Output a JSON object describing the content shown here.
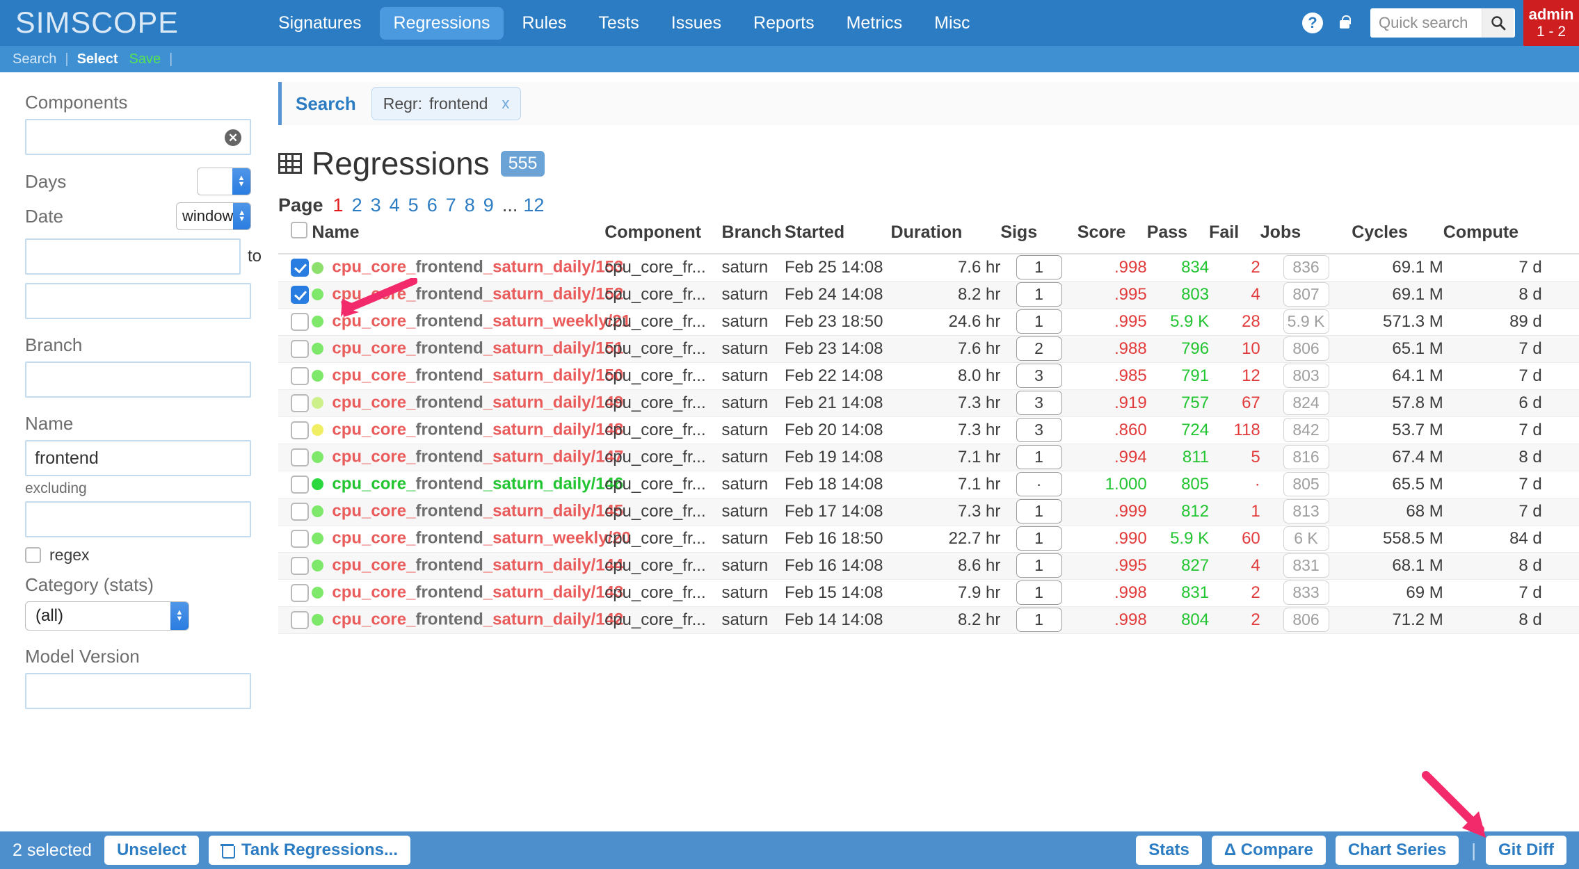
{
  "brand": "SIMSCOPE",
  "nav": {
    "items": [
      {
        "label": "Signatures",
        "active": false
      },
      {
        "label": "Regressions",
        "active": true
      },
      {
        "label": "Rules",
        "active": false
      },
      {
        "label": "Tests",
        "active": false
      },
      {
        "label": "Issues",
        "active": false
      },
      {
        "label": "Reports",
        "active": false
      },
      {
        "label": "Metrics",
        "active": false
      },
      {
        "label": "Misc",
        "active": false
      }
    ],
    "help_icon": "help-circle-icon",
    "lock_icon": "lock-icon",
    "search_icon": "search-icon",
    "quick_search_placeholder": "Quick search",
    "quick_search_value": "",
    "user_name": "admin",
    "user_sub": "1 - 2"
  },
  "subnav": {
    "search": "Search",
    "sep": "|",
    "select": "Select",
    "save": "Save",
    "sep2": "|"
  },
  "sidebar": {
    "components_label": "Components",
    "components_value": "",
    "clear_icon": "clear-circle-icon",
    "days_label": "Days",
    "days_value": "",
    "date_label": "Date",
    "date_mode": "window",
    "date_from": "",
    "date_to_label": "to",
    "date_to": "",
    "branch_label": "Branch",
    "branch_value": "",
    "name_label": "Name",
    "name_value": "frontend",
    "excluding_label": "excluding",
    "excluding_value": "",
    "regex_label": "regex",
    "category_label": "Category (stats)",
    "category_value": "(all)",
    "model_version_label": "Model Version"
  },
  "search_panel": {
    "title": "Search",
    "chip_key": "Regr:",
    "chip_value": "frontend",
    "chip_close": "x"
  },
  "page": {
    "grid_icon": "grid-icon",
    "title": "Regressions",
    "count": "555",
    "pager_label": "Page",
    "pages": [
      "1",
      "2",
      "3",
      "4",
      "5",
      "6",
      "7",
      "8",
      "9"
    ],
    "pager_dots": "...",
    "last_page": "12",
    "current_page": "1"
  },
  "table": {
    "columns": [
      "Name",
      "Component",
      "Branch",
      "Started",
      "Duration",
      "Sigs",
      "Score",
      "Pass",
      "Fail",
      "Jobs",
      "Cycles",
      "Compute",
      ""
    ],
    "rows": [
      {
        "checked": true,
        "dot": "#8ce06b",
        "name_pre": "cpu_core_",
        "name_match": "frontend",
        "name_post": "_saturn_daily/153",
        "ok": false,
        "component": "cpu_core_fr...",
        "branch": "saturn",
        "started": "Feb 25 14:08",
        "duration": "7.6 hr",
        "sigs": "1",
        "score": ".998",
        "pass": "834",
        "fail": "2",
        "jobs": "836",
        "cycles": "69.1 M",
        "compute": "7 d"
      },
      {
        "checked": true,
        "dot": "#7ee86a",
        "name_pre": "cpu_core_",
        "name_match": "frontend",
        "name_post": "_saturn_daily/152",
        "ok": false,
        "component": "cpu_core_fr...",
        "branch": "saturn",
        "started": "Feb 24 14:08",
        "duration": "8.2 hr",
        "sigs": "1",
        "score": ".995",
        "pass": "803",
        "fail": "4",
        "jobs": "807",
        "cycles": "69.1 M",
        "compute": "8 d"
      },
      {
        "checked": false,
        "dot": "#7ee86a",
        "name_pre": "cpu_core_",
        "name_match": "frontend",
        "name_post": "_saturn_weekly/21",
        "ok": false,
        "component": "cpu_core_fr...",
        "branch": "saturn",
        "started": "Feb 23 18:50",
        "duration": "24.6 hr",
        "sigs": "1",
        "score": ".995",
        "pass": "5.9 K",
        "fail": "28",
        "jobs": "5.9 K",
        "cycles": "571.3 M",
        "compute": "89 d"
      },
      {
        "checked": false,
        "dot": "#7ee86a",
        "name_pre": "cpu_core_",
        "name_match": "frontend",
        "name_post": "_saturn_daily/151",
        "ok": false,
        "component": "cpu_core_fr...",
        "branch": "saturn",
        "started": "Feb 23 14:08",
        "duration": "7.6 hr",
        "sigs": "2",
        "score": ".988",
        "pass": "796",
        "fail": "10",
        "jobs": "806",
        "cycles": "65.1 M",
        "compute": "7 d"
      },
      {
        "checked": false,
        "dot": "#7ee86a",
        "name_pre": "cpu_core_",
        "name_match": "frontend",
        "name_post": "_saturn_daily/150",
        "ok": false,
        "component": "cpu_core_fr...",
        "branch": "saturn",
        "started": "Feb 22 14:08",
        "duration": "8.0 hr",
        "sigs": "3",
        "score": ".985",
        "pass": "791",
        "fail": "12",
        "jobs": "803",
        "cycles": "64.1 M",
        "compute": "7 d"
      },
      {
        "checked": false,
        "dot": "#cdf08a",
        "name_pre": "cpu_core_",
        "name_match": "frontend",
        "name_post": "_saturn_daily/149",
        "ok": false,
        "component": "cpu_core_fr...",
        "branch": "saturn",
        "started": "Feb 21 14:08",
        "duration": "7.3 hr",
        "sigs": "3",
        "score": ".919",
        "pass": "757",
        "fail": "67",
        "jobs": "824",
        "cycles": "57.8 M",
        "compute": "6 d"
      },
      {
        "checked": false,
        "dot": "#f0ee63",
        "name_pre": "cpu_core_",
        "name_match": "frontend",
        "name_post": "_saturn_daily/148",
        "ok": false,
        "component": "cpu_core_fr...",
        "branch": "saturn",
        "started": "Feb 20 14:08",
        "duration": "7.3 hr",
        "sigs": "3",
        "score": ".860",
        "pass": "724",
        "fail": "118",
        "jobs": "842",
        "cycles": "53.7 M",
        "compute": "7 d"
      },
      {
        "checked": false,
        "dot": "#7ee86a",
        "name_pre": "cpu_core_",
        "name_match": "frontend",
        "name_post": "_saturn_daily/147",
        "ok": false,
        "component": "cpu_core_fr...",
        "branch": "saturn",
        "started": "Feb 19 14:08",
        "duration": "7.1 hr",
        "sigs": "1",
        "score": ".994",
        "pass": "811",
        "fail": "5",
        "jobs": "816",
        "cycles": "67.4 M",
        "compute": "8 d"
      },
      {
        "checked": false,
        "dot": "#2ad83e",
        "name_pre": "cpu_core_",
        "name_match": "frontend",
        "name_post": "_saturn_daily/146",
        "ok": true,
        "component": "cpu_core_fr...",
        "branch": "saturn",
        "started": "Feb 18 14:08",
        "duration": "7.1 hr",
        "sigs": "·",
        "score": "1.000",
        "pass": "805",
        "fail": "·",
        "jobs": "805",
        "cycles": "65.5 M",
        "compute": "7 d"
      },
      {
        "checked": false,
        "dot": "#7ee86a",
        "name_pre": "cpu_core_",
        "name_match": "frontend",
        "name_post": "_saturn_daily/145",
        "ok": false,
        "component": "cpu_core_fr...",
        "branch": "saturn",
        "started": "Feb 17 14:08",
        "duration": "7.3 hr",
        "sigs": "1",
        "score": ".999",
        "pass": "812",
        "fail": "1",
        "jobs": "813",
        "cycles": "68 M",
        "compute": "7 d"
      },
      {
        "checked": false,
        "dot": "#7ee86a",
        "name_pre": "cpu_core_",
        "name_match": "frontend",
        "name_post": "_saturn_weekly/20",
        "ok": false,
        "component": "cpu_core_fr...",
        "branch": "saturn",
        "started": "Feb 16 18:50",
        "duration": "22.7 hr",
        "sigs": "1",
        "score": ".990",
        "pass": "5.9 K",
        "fail": "60",
        "jobs": "6 K",
        "cycles": "558.5 M",
        "compute": "84 d"
      },
      {
        "checked": false,
        "dot": "#7ee86a",
        "name_pre": "cpu_core_",
        "name_match": "frontend",
        "name_post": "_saturn_daily/144",
        "ok": false,
        "component": "cpu_core_fr...",
        "branch": "saturn",
        "started": "Feb 16 14:08",
        "duration": "8.6 hr",
        "sigs": "1",
        "score": ".995",
        "pass": "827",
        "fail": "4",
        "jobs": "831",
        "cycles": "68.1 M",
        "compute": "8 d"
      },
      {
        "checked": false,
        "dot": "#7ee86a",
        "name_pre": "cpu_core_",
        "name_match": "frontend",
        "name_post": "_saturn_daily/143",
        "ok": false,
        "component": "cpu_core_fr...",
        "branch": "saturn",
        "started": "Feb 15 14:08",
        "duration": "7.9 hr",
        "sigs": "1",
        "score": ".998",
        "pass": "831",
        "fail": "2",
        "jobs": "833",
        "cycles": "69 M",
        "compute": "7 d"
      },
      {
        "checked": false,
        "dot": "#7ee86a",
        "name_pre": "cpu_core_",
        "name_match": "frontend",
        "name_post": "_saturn_daily/142",
        "ok": false,
        "component": "cpu_core_fr...",
        "branch": "saturn",
        "started": "Feb 14 14:08",
        "duration": "8.2 hr",
        "sigs": "1",
        "score": ".998",
        "pass": "804",
        "fail": "2",
        "jobs": "806",
        "cycles": "71.2 M",
        "compute": "8 d"
      }
    ]
  },
  "bottom": {
    "selected_count": "2 selected",
    "unselect": "Unselect",
    "tank_icon": "trash-icon",
    "tank": "Tank Regressions...",
    "stats": "Stats",
    "compare": "Δ Compare",
    "chart_series": "Chart Series",
    "sep": "|",
    "git_diff": "Git Diff"
  },
  "colors": {
    "brand_blue": "#2b7cc3",
    "subnav_blue": "#3f90d2",
    "accent_red": "#cf1e20",
    "link_red": "#ea5b5b",
    "pass_green": "#22c531",
    "annotation_pink": "#f2296a"
  }
}
